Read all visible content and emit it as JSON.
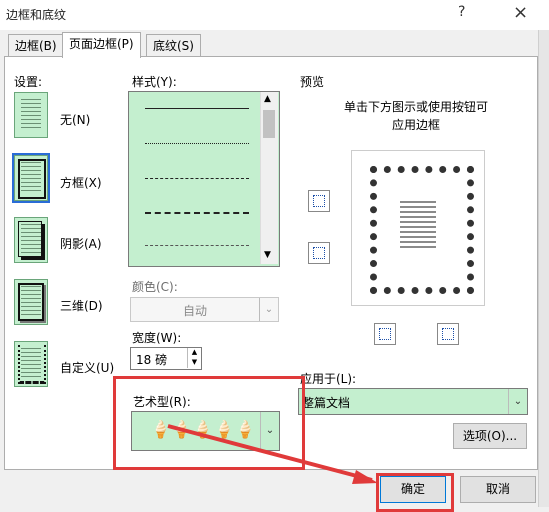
{
  "window": {
    "title": "边框和底纹",
    "help_label": "?",
    "close_label": "×"
  },
  "tabs": [
    {
      "label": "边框(B)"
    },
    {
      "label": "页面边框(P)"
    },
    {
      "label": "底纹(S)"
    }
  ],
  "settings": {
    "heading": "设置:",
    "items": [
      {
        "label": "无(N)"
      },
      {
        "label": "方框(X)"
      },
      {
        "label": "阴影(A)"
      },
      {
        "label": "三维(D)"
      },
      {
        "label": "自定义(U)"
      }
    ]
  },
  "style": {
    "label": "样式(Y):"
  },
  "color": {
    "label": "颜色(C):",
    "value": "自动"
  },
  "width": {
    "label": "宽度(W):",
    "value": "18 磅"
  },
  "art": {
    "label": "艺术型(R):",
    "glyph": "🍦"
  },
  "preview": {
    "heading": "预览",
    "hint_line1": "单击下方图示或使用按钮可",
    "hint_line2": "应用边框"
  },
  "apply_to": {
    "label": "应用于(L):",
    "value": "整篇文档"
  },
  "buttons": {
    "options": "选项(O)...",
    "ok": "确定",
    "cancel": "取消"
  },
  "colors": {
    "accent_green": "#c4efcf",
    "annotation_red": "#e03a3a"
  }
}
